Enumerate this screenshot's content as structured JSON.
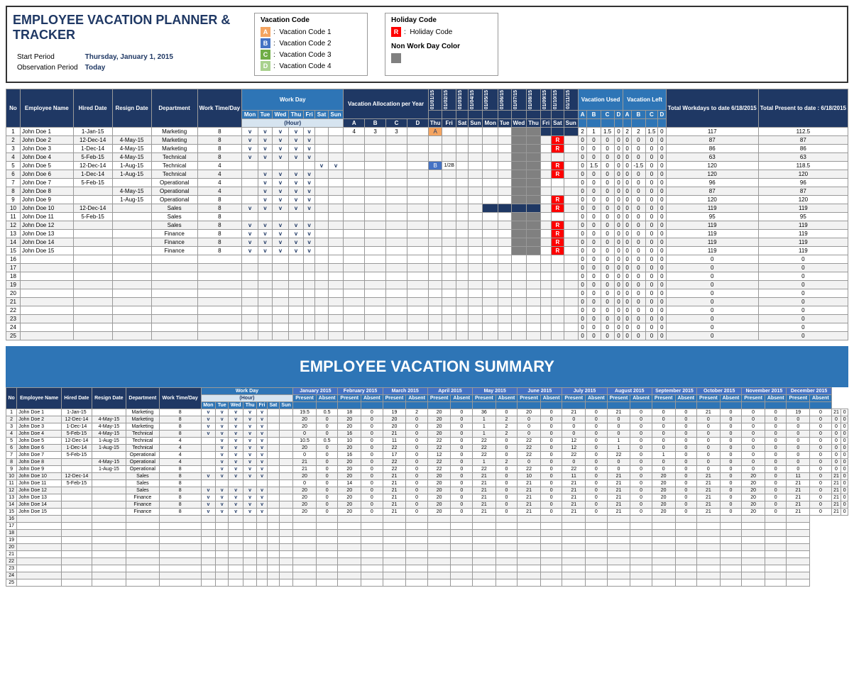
{
  "header": {
    "title": "EMPLOYEE VACATION PLANNER & TRACKER",
    "start_period_label": "Start Period",
    "start_period_value": "Thursday, January 1, 2015",
    "observation_label": "Observation Period",
    "observation_value": "Today"
  },
  "vacation_code": {
    "title": "Vacation Code",
    "items": [
      {
        "code": "A",
        "label": "Vacation Code 1",
        "color": "#f4a460"
      },
      {
        "code": "B",
        "label": "Vacation Code 2",
        "color": "#4472c4"
      },
      {
        "code": "C",
        "label": "Vacation Code 3",
        "color": "#70ad47"
      },
      {
        "code": "D",
        "label": "Vacation Code 4",
        "color": "#a9d18e"
      }
    ]
  },
  "holiday_code": {
    "title": "Holiday Code",
    "items": [
      {
        "code": "R",
        "label": "Holiday Code",
        "color": "#ff0000"
      }
    ]
  },
  "non_work": {
    "title": "Non Work Day Color",
    "color": "#808080"
  },
  "summary_title": "EMPLOYEE VACATION SUMMARY",
  "employees": [
    {
      "no": 1,
      "name": "John Doe 1",
      "hired": "1-Jan-15",
      "resign": "",
      "dept": "Marketing",
      "work_time": 8
    },
    {
      "no": 2,
      "name": "John Doe 2",
      "hired": "12-Dec-14",
      "resign": "4-May-15",
      "dept": "Marketing",
      "work_time": 8
    },
    {
      "no": 3,
      "name": "John Doe 3",
      "hired": "1-Dec-14",
      "resign": "4-May-15",
      "dept": "Marketing",
      "work_time": 8
    },
    {
      "no": 4,
      "name": "John Doe 4",
      "hired": "5-Feb-15",
      "resign": "4-May-15",
      "dept": "Technical",
      "work_time": 8
    },
    {
      "no": 5,
      "name": "John Doe 5",
      "hired": "12-Dec-14",
      "resign": "1-Aug-15",
      "dept": "Technical",
      "work_time": 4
    },
    {
      "no": 6,
      "name": "John Doe 6",
      "hired": "1-Dec-14",
      "resign": "1-Aug-15",
      "dept": "Technical",
      "work_time": 4
    },
    {
      "no": 7,
      "name": "John Doe 7",
      "hired": "5-Feb-15",
      "resign": "",
      "dept": "Operational",
      "work_time": 4
    },
    {
      "no": 8,
      "name": "John Doe 8",
      "hired": "",
      "resign": "4-May-15",
      "dept": "Operational",
      "work_time": 4
    },
    {
      "no": 9,
      "name": "John Doe 9",
      "hired": "",
      "resign": "1-Aug-15",
      "dept": "Operational",
      "work_time": 8
    },
    {
      "no": 10,
      "name": "John Doe 10",
      "hired": "12-Dec-14",
      "resign": "",
      "dept": "Sales",
      "work_time": 8
    },
    {
      "no": 11,
      "name": "John Doe 11",
      "hired": "5-Feb-15",
      "resign": "",
      "dept": "Sales",
      "work_time": 8
    },
    {
      "no": 12,
      "name": "John Doe 12",
      "hired": "",
      "resign": "",
      "dept": "Sales",
      "work_time": 8
    },
    {
      "no": 13,
      "name": "John Doe 13",
      "hired": "",
      "resign": "",
      "dept": "Finance",
      "work_time": 8
    },
    {
      "no": 14,
      "name": "John Doe 14",
      "hired": "",
      "resign": "",
      "dept": "Finance",
      "work_time": 8
    },
    {
      "no": 15,
      "name": "John Doe 15",
      "hired": "",
      "resign": "",
      "dept": "Finance",
      "work_time": 8
    }
  ]
}
